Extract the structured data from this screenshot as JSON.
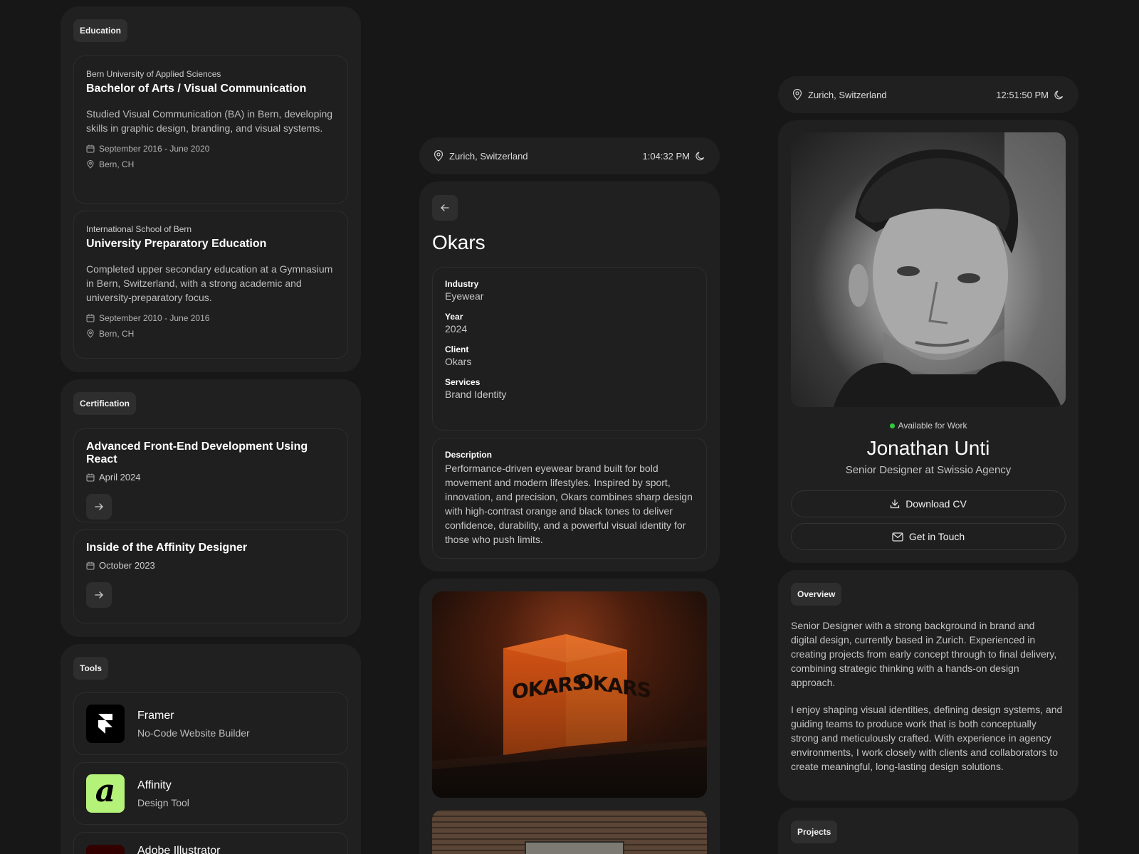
{
  "education": {
    "tag": "Education",
    "items": [
      {
        "school": "Bern University of Applied Sciences",
        "degree": "Bachelor of Arts / Visual Communication",
        "description": "Studied Visual Communication (BA) in Bern, developing skills in graphic design, branding, and visual systems.",
        "dates": "September 2016 - June 2020",
        "location": "Bern, CH"
      },
      {
        "school": "International School of Bern",
        "degree": "University Preparatory Education",
        "description": "Completed upper secondary education at a Gymnasium in Bern, Switzerland, with a strong academic and university-preparatory focus.",
        "dates": "September 2010 - June 2016",
        "location": "Bern, CH"
      }
    ]
  },
  "certification": {
    "tag": "Certification",
    "items": [
      {
        "title": "Advanced Front-End Development Using React",
        "date": "April 2024"
      },
      {
        "title": "Inside of the Affinity Designer",
        "date": "October 2023"
      }
    ]
  },
  "tools": {
    "tag": "Tools",
    "items": [
      {
        "name": "Framer",
        "subtitle": "No-Code Website Builder",
        "icon": "framer-logo",
        "color": "#000000"
      },
      {
        "name": "Affinity",
        "subtitle": "Design Tool",
        "icon": "affinity-logo",
        "color": "#b5f27a"
      },
      {
        "name": "Adobe Illustrator",
        "subtitle": "",
        "icon": "illustrator-logo",
        "color": "#330000"
      }
    ]
  },
  "project": {
    "location": "Zurich, Switzerland",
    "time": "1:04:32 PM",
    "title": "Okars",
    "fields": [
      {
        "label": "Industry",
        "value": "Eyewear"
      },
      {
        "label": "Year",
        "value": "2024"
      },
      {
        "label": "Client",
        "value": "Okars"
      },
      {
        "label": "Services",
        "value": "Brand Identity"
      }
    ],
    "description_label": "Description",
    "description": "Performance-driven eyewear brand built for bold movement and modern lifestyles. Inspired by sport, innovation, and precision, Okars combines sharp design with high-contrast orange and black tones to deliver confidence, durability, and a powerful visual identity for those who push limits.",
    "sign_text": "OKARS"
  },
  "profile": {
    "location": "Zurich, Switzerland",
    "time": "12:51:50 PM",
    "status": "Available for Work",
    "status_color": "#2ecc40",
    "name": "Jonathan Unti",
    "role": "Senior Designer at Swissio Agency",
    "download_label": "Download CV",
    "contact_label": "Get in Touch"
  },
  "overview": {
    "tag": "Overview",
    "paragraphs": [
      "Senior Designer with a strong background in brand and digital design, currently based in Zurich. Experienced in creating projects from early concept through to final delivery, combining strategic thinking with a hands-on design approach.",
      "I enjoy shaping visual identities, defining design systems, and guiding teams to produce work that is both conceptually strong and meticulously crafted. With experience in agency environments, I work closely with clients and collaborators to create meaningful, long-lasting design solutions."
    ]
  },
  "projects": {
    "tag": "Projects"
  }
}
